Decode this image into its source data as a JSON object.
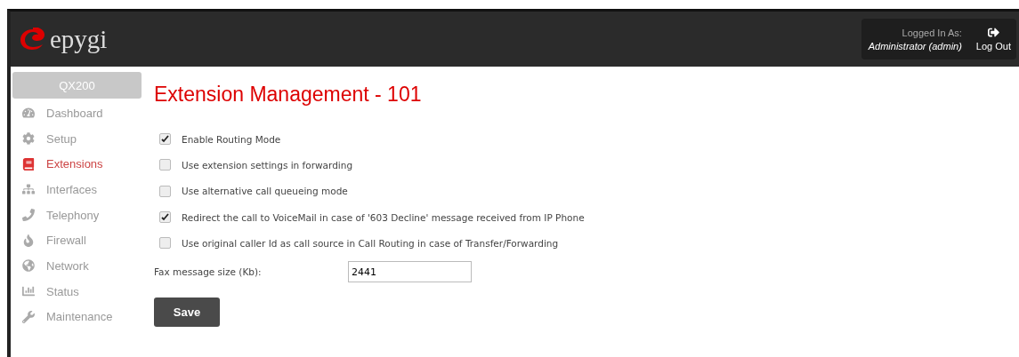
{
  "header": {
    "logo": "epygi",
    "login_label": "Logged In As:",
    "login_user": "Administrator (admin)",
    "logout": "Log Out"
  },
  "sidebar": {
    "device": "QX200",
    "items": [
      {
        "label": "Dashboard",
        "selected": false
      },
      {
        "label": "Setup",
        "selected": false
      },
      {
        "label": "Extensions",
        "selected": true
      },
      {
        "label": "Interfaces",
        "selected": false
      },
      {
        "label": "Telephony",
        "selected": false
      },
      {
        "label": "Firewall",
        "selected": false
      },
      {
        "label": "Network",
        "selected": false
      },
      {
        "label": "Status",
        "selected": false
      },
      {
        "label": "Maintenance",
        "selected": false
      }
    ]
  },
  "title": "Extension Management - 101",
  "options": [
    {
      "label": "Enable Routing Mode",
      "checked": true
    },
    {
      "label": "Use extension settings in forwarding",
      "checked": false
    },
    {
      "label": "Use alternative call queueing mode",
      "checked": false
    },
    {
      "label": "Redirect the call to VoiceMail in case of '603 Decline' message received from IP Phone",
      "checked": true
    },
    {
      "label": "Use original caller Id as call source in Call Routing in case of Transfer/Forwarding",
      "checked": false
    }
  ],
  "fax": {
    "label": "Fax message size (Kb):",
    "value": "2441"
  },
  "save": "Save"
}
